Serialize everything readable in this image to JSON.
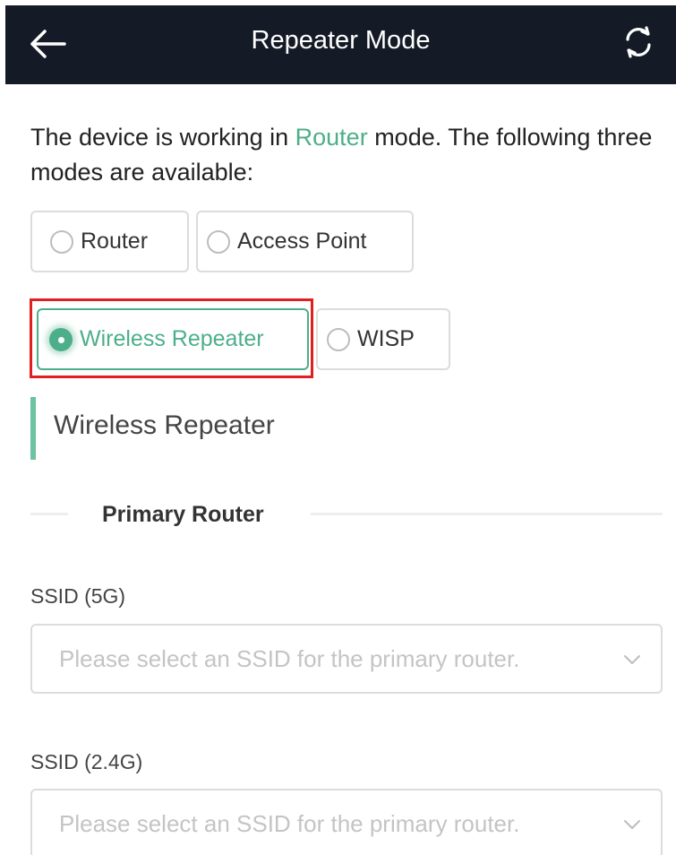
{
  "header": {
    "title": "Repeater Mode",
    "back_icon": "arrow-left-icon",
    "refresh_icon": "refresh-icon",
    "background": "#151b26"
  },
  "intro": {
    "prefix": "The device is working in ",
    "current_mode": "Router",
    "suffix": " mode. The following three modes are available:"
  },
  "modes": [
    {
      "label": "Router",
      "selected": false
    },
    {
      "label": "Access Point",
      "selected": false
    },
    {
      "label": "Wireless Repeater",
      "selected": true
    },
    {
      "label": "WISP",
      "selected": false
    }
  ],
  "section": {
    "title": "Wireless Repeater",
    "subtitle": "Primary Router"
  },
  "fields": [
    {
      "label": "SSID (5G)",
      "placeholder": "Please select an SSID for the primary router."
    },
    {
      "label": "SSID (2.4G)",
      "placeholder": "Please select an SSID for the primary router."
    }
  ],
  "colors": {
    "accent": "#4caf8a",
    "highlight": "#e02020"
  }
}
